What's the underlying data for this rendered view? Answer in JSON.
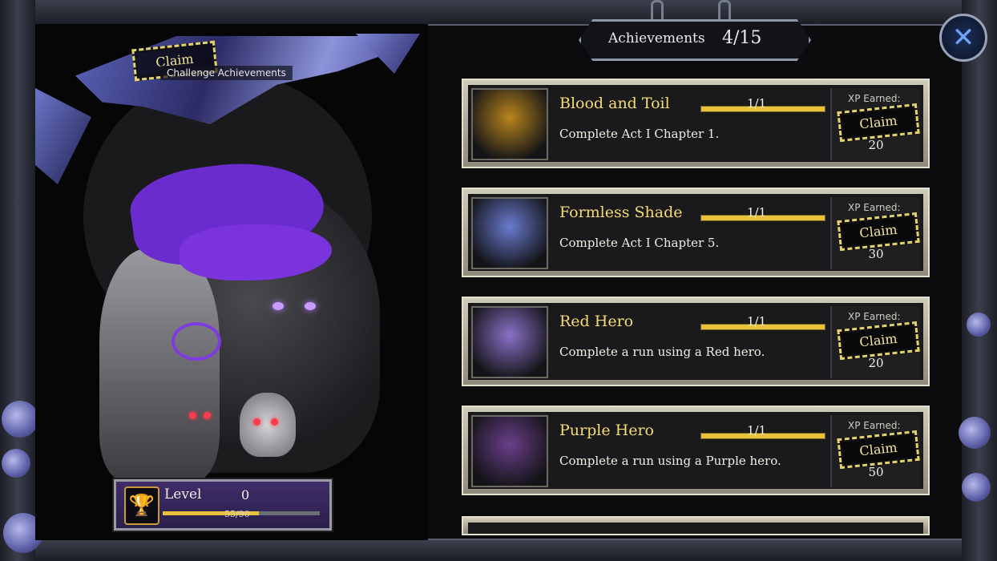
{
  "header": {
    "title": "Achievements",
    "count": "4/15"
  },
  "banner": {
    "claim_label": "Claim",
    "subtitle": "Challenge Achievements"
  },
  "level": {
    "label": "Level",
    "value": "0",
    "xp_text": "55/90",
    "progress": 0.61
  },
  "close": {
    "icon": "close-x-icon",
    "glyph": "✕"
  },
  "achievements": [
    {
      "name": "Blood and Toil",
      "progress": "1/1",
      "description": "Complete Act I Chapter 1.",
      "xp_label": "XP Earned:",
      "claim_label": "Claim",
      "xp": "20",
      "portrait_color": "#b8851c"
    },
    {
      "name": "Formless Shade",
      "progress": "1/1",
      "description": "Complete Act I Chapter 5.",
      "xp_label": "XP Earned:",
      "claim_label": "Claim",
      "xp": "30",
      "portrait_color": "#6a7bd0"
    },
    {
      "name": "Red Hero",
      "progress": "1/1",
      "description": "Complete a run using a Red hero.",
      "xp_label": "XP Earned:",
      "claim_label": "Claim",
      "xp": "20",
      "portrait_color": "#8a72c8"
    },
    {
      "name": "Purple Hero",
      "progress": "1/1",
      "description": "Complete a run using a Purple hero.",
      "xp_label": "XP Earned:",
      "claim_label": "Claim",
      "xp": "50",
      "portrait_color": "#6a3f8a"
    }
  ],
  "colors": {
    "accent_gold": "#f5dc72",
    "claim_stamp": "#e5d36a",
    "level_purple": "#3f2d6a",
    "close_blue": "#6fa3ff"
  }
}
